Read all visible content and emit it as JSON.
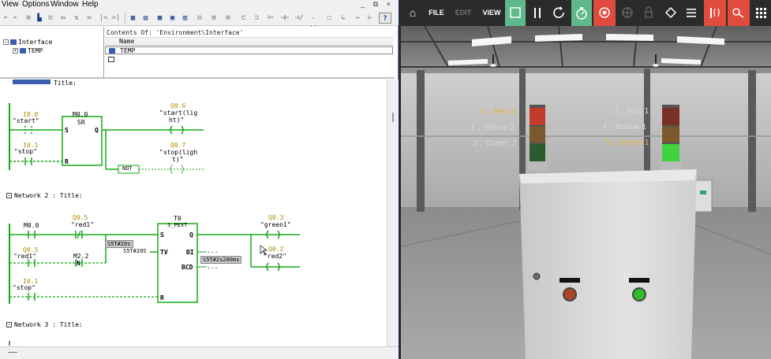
{
  "menu": {
    "items": [
      "View",
      "Options",
      "Window",
      "Help"
    ],
    "window_controls": "_ ⧉ ×"
  },
  "tree": {
    "root": "Interface",
    "child": "TEMP"
  },
  "contents": {
    "header": "Contents Of: 'Environment\\Interface'",
    "column": "Name",
    "row": "TEMP"
  },
  "ladder": {
    "top_label": "Title:",
    "net1": {
      "i00_addr": "I0.0",
      "i00_name": "\"start\"",
      "m00_addr": "M0.0",
      "sr": "SR",
      "s": "S",
      "q": "Q",
      "r": "R",
      "i01_addr": "I0.1",
      "i01_name": "\"stop\"",
      "q06_addr": "Q0.6",
      "q06_name": "\"start(lig",
      "q06_name2": "ht)\"",
      "q07_addr": "Q0.7",
      "q07_name": "\"stop(ligh",
      "q07_name2": "t)\"",
      "not": "NOT"
    },
    "net2_title": "Network 2 : Title:",
    "net2": {
      "m00": "M0.0",
      "q05_addr": "Q0.5",
      "q05_name": "\"red1\"",
      "q05b_addr": "Q0.5",
      "q05b_name": "\"red1\"",
      "m22": "M2.2",
      "n": "N",
      "i01_addr": "I0.1",
      "i01_name": "\"stop\"",
      "timer": "T0",
      "spext": "S_PEXT",
      "s": "S",
      "q": "Q",
      "tv": "TV",
      "bi": "BI",
      "bcd": "BCD",
      "r": "R",
      "tv_box": "S5T#20s",
      "tv_val": "S5T#20S",
      "bi_val": "...",
      "bcd_val": "...",
      "time_box": "S5T#2s200ms",
      "q03_addr": "Q0.3",
      "q03_name": "\"green1\"",
      "q02_addr": "Q0.2",
      "q02_name": "\"red2\""
    },
    "net3_title": "Network 3 : Title:"
  },
  "sim": {
    "toolbar": {
      "home": "⌂",
      "file": "FILE",
      "edit": "EDIT",
      "view": "VIEW"
    },
    "left_tower_labels": [
      {
        "text": "0 : Red 2",
        "color": "#e8b24a"
      },
      {
        "text": "1 : Yellow 2",
        "color": "#d6d6d6"
      },
      {
        "text": "2 : Green 2",
        "color": "#d6d6d6"
      }
    ],
    "right_tower_labels": [
      {
        "text": "3 : Red 1",
        "color": "#d6d6d6"
      },
      {
        "text": "4 : Yellow 1",
        "color": "#d6d6d6"
      },
      {
        "text": "5 : Green 1",
        "color": "#e8b24a"
      }
    ],
    "colors": {
      "accent_green": "#5fb98a",
      "accent_red": "#e14b3e",
      "ladder_green": "#16a816"
    }
  }
}
